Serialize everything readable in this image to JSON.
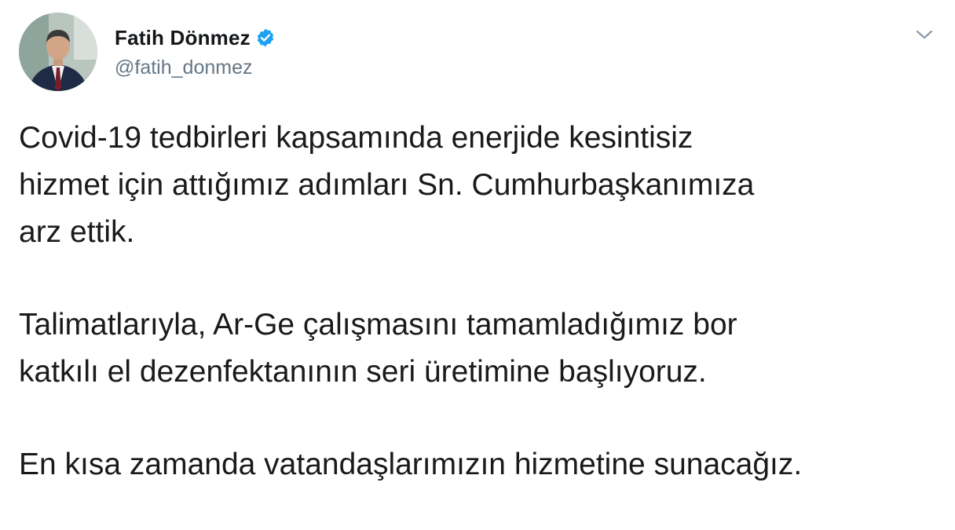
{
  "author": {
    "name": "Fatih Dönmez",
    "handle": "@fatih_donmez",
    "verified": true,
    "avatar_icon": "profile-photo"
  },
  "header": {
    "menu_icon": "chevron-down-icon"
  },
  "tweet": {
    "paragraphs": [
      "Covid-19 tedbirleri kapsamında enerjide kesintisiz\nhizmet için attığımız adımları Sn. Cumhurbaşkanımıza\narz ettik.",
      "Talimatlarıyla, Ar-Ge çalışmasını tamamladığımız bor\nkatkılı el dezenfektanının seri üretimine başlıyoruz.",
      "En kısa zamanda vatandaşlarımızın hizmetine sunacağız."
    ]
  },
  "colors": {
    "verified_blue": "#1da1f2",
    "handle_gray": "#657786",
    "text": "#14171a"
  }
}
